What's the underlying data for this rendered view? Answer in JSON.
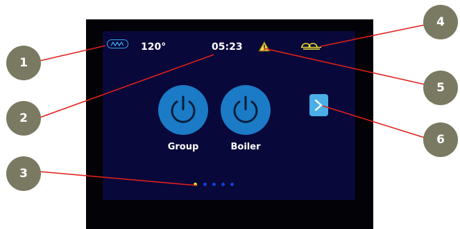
{
  "status_bar": {
    "temperature": "120°",
    "time": "05:23",
    "heater_icon": "heater-element-icon",
    "warning_icon": "warning-icon",
    "cups_icon": "cup-warmer-icon"
  },
  "buttons": [
    {
      "label": "Group",
      "icon": "power-icon"
    },
    {
      "label": "Boiler",
      "icon": "power-icon"
    }
  ],
  "navigation": {
    "next_icon": "chevron-right-icon",
    "page_count": 5,
    "active_page": 1
  },
  "callouts": [
    "1",
    "2",
    "3",
    "4",
    "5",
    "6"
  ],
  "colors": {
    "screen_background": "#08083a",
    "bezel": "#020207",
    "power_button": "#1b7bc6",
    "accent_blue": "#3ba6f0",
    "warning_yellow": "#f2e233",
    "callout_fill": "#7a7a63",
    "callout_line": "#e0201b"
  }
}
